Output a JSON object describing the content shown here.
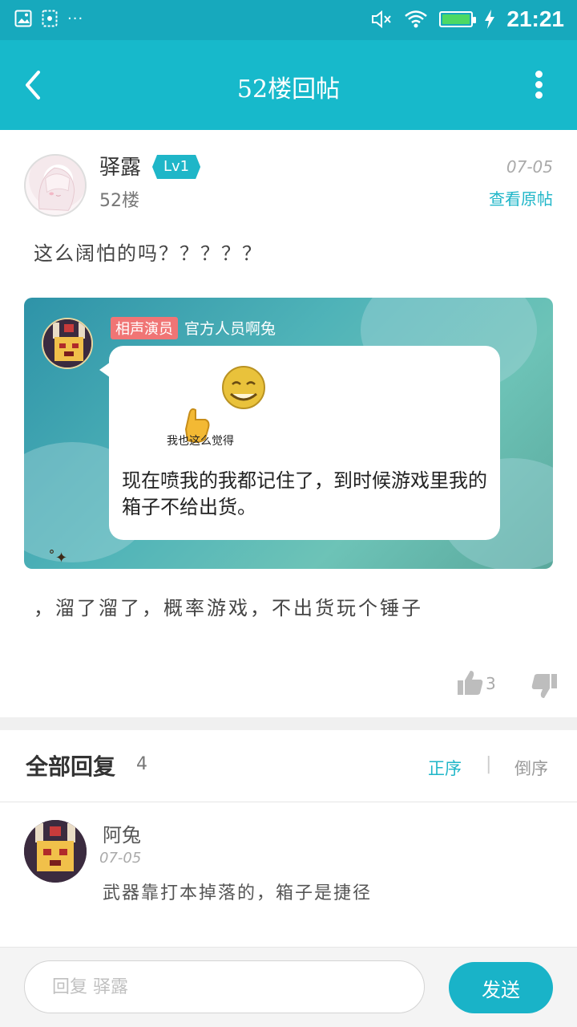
{
  "status_bar": {
    "time": "21:21",
    "icons": [
      "image-icon",
      "screenshot-icon",
      "more-dots-icon",
      "mute-icon",
      "wifi-icon",
      "battery-icon",
      "charging-icon"
    ],
    "battery_level": 1.0
  },
  "header": {
    "title": "52楼回帖"
  },
  "post": {
    "author": "驿露",
    "level": "Lv1",
    "floor": "52楼",
    "date": "07-05",
    "view_original": "查看原帖",
    "text_before": "这么阔怕的吗？？？？？",
    "image": {
      "role_tag": "相声演员",
      "name": "官方人员啊兔",
      "meme_caption": "我也这么觉得",
      "bubble_text": "现在喷我的我都记住了，到时候游戏里我的箱子不给出货。"
    },
    "text_after": "，溜了溜了，概率游戏，不出货玩个锤子",
    "likes": "3"
  },
  "replies": {
    "title": "全部回复",
    "count": "4",
    "sort_asc": "正序",
    "separator": "|",
    "sort_desc": "倒序",
    "items": [
      {
        "author": "阿兔",
        "date": "07-05",
        "text": "武器靠打本掉落的，箱子是捷径"
      }
    ]
  },
  "composer": {
    "placeholder": "回复 驿露",
    "send_label": "发送"
  },
  "colors": {
    "accent": "#17b9cb",
    "status_bar": "#17a9bd",
    "role_tag": "#f07575"
  }
}
